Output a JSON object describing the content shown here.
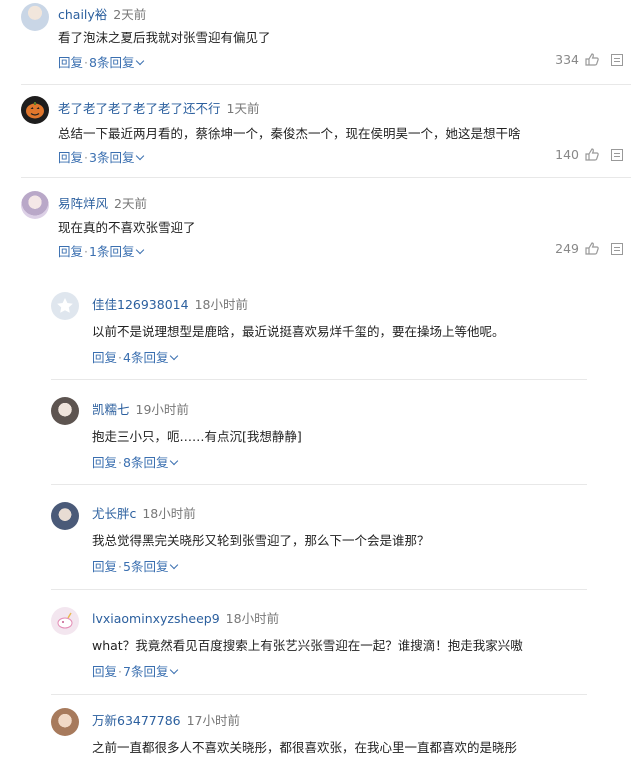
{
  "comments": [
    {
      "user": "chaily裕",
      "time": "2天前",
      "text": "看了泡沫之夏后我就对张雪迎有偏见了",
      "reply_label": "回复",
      "replies_label": "8条回复",
      "likes": "334",
      "avatar_color": "#c9d6e6",
      "avatar_icon": "avatar-photo-icon"
    },
    {
      "user": "老了老了老了老了老了还不行",
      "time": "1天前",
      "text": "总结一下最近两月看的，蔡徐坤一个，秦俊杰一个，现在侯明昊一个，她这是想干啥",
      "reply_label": "回复",
      "replies_label": "3条回复",
      "likes": "140",
      "avatar_color": "#e0762c",
      "avatar_icon": "pumpkin-avatar-icon"
    },
    {
      "user": "易阵烊风",
      "time": "2天前",
      "text": "现在真的不喜欢张雪迎了",
      "reply_label": "回复",
      "replies_label": "1条回复",
      "likes": "249",
      "avatar_color": "#b9a8c8",
      "avatar_icon": "avatar-photo-icon"
    }
  ],
  "replies": [
    {
      "user": "佳佳126938014",
      "time": "18小时前",
      "text": "以前不是说理想型是鹿晗，最近说挺喜欢易烊千玺的，要在操场上等他呢。",
      "reply_label": "回复",
      "replies_label": "4条回复",
      "avatar_color": "#dfe6ee",
      "avatar_icon": "default-star-avatar-icon"
    },
    {
      "user": "凯糯七",
      "time": "19小时前",
      "text": "抱走三小只，呃……有点沉[我想静静]",
      "reply_label": "回复",
      "replies_label": "8条回复",
      "avatar_color": "#8f8a88",
      "avatar_icon": "avatar-photo-icon"
    },
    {
      "user": "尤长胖c",
      "time": "18小时前",
      "text": "我总觉得黑完关晓彤又轮到张雪迎了，那么下一个会是谁那？",
      "reply_label": "回复",
      "replies_label": "5条回复",
      "avatar_color": "#4a5a78",
      "avatar_icon": "avatar-photo-icon"
    },
    {
      "user": "lvxiaominxyzsheep9",
      "time": "18小时前",
      "text": "what？我竟然看见百度搜索上有张艺兴张雪迎在一起？谁搜滴！抱走我家兴嗷",
      "reply_label": "回复",
      "replies_label": "7条回复",
      "avatar_color": "#f3e6ef",
      "avatar_icon": "unicorn-avatar-icon"
    },
    {
      "user": "万新63477786",
      "time": "17小时前",
      "text": "之前一直都很多人不喜欢关晓彤，都很喜欢张，在我心里一直都喜欢的是晓彤",
      "avatar_color": "#d7b59a",
      "avatar_icon": "avatar-photo-icon"
    }
  ]
}
